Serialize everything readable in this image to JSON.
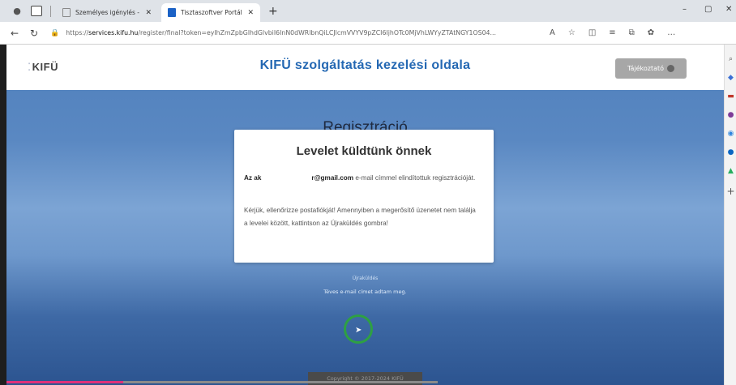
{
  "browser": {
    "tabs": [
      {
        "title": "Személyes igénylés - Tisztaszoftv",
        "active": false
      },
      {
        "title": "Tisztaszoftver Portál",
        "active": true
      }
    ],
    "url_prefix": "https://",
    "url_host": "services.kifu.hu",
    "url_rest": "/register/final?token=eyIhZmZpbGlhdGlvbiI6InN0dWRlbnQiLCJlcmVVYV9pZCI6IjhOTc0MjVhLWYyZTAtNGY1OS04...",
    "new_tab_label": "+",
    "controls": {
      "minimize": "–",
      "restore": "▢",
      "close": "✕"
    }
  },
  "site": {
    "logo_text": "KIFÜ",
    "title": "KIFÜ szolgáltatás kezelési oldala",
    "info_button": "Tájékoztató"
  },
  "page": {
    "heading": "Regisztráció",
    "card": {
      "title": "Levelet küldtünk önnek",
      "p1_prefix": "Az ak",
      "p1_email": "r@gmail.com",
      "p1_suffix": " e-mail címmel elindítottuk regisztrációját.",
      "p2": "Kérjük, ellenőrizze postafiókját! Amennyiben a megerősítő üzenetet nem találja a levelei között, kattintson az Újraküldés gombra!"
    },
    "resend_link": "Újraküldés",
    "wrong_email_link": "Téves e-mail címet adtam meg.",
    "footer": "Copyright © 2017-2024 KIFÜ"
  },
  "video_progress": 0.27,
  "colors": {
    "site_title": "#2468b3",
    "info_button": "#a7a7a7",
    "cursor_ring": "#2ea043"
  }
}
